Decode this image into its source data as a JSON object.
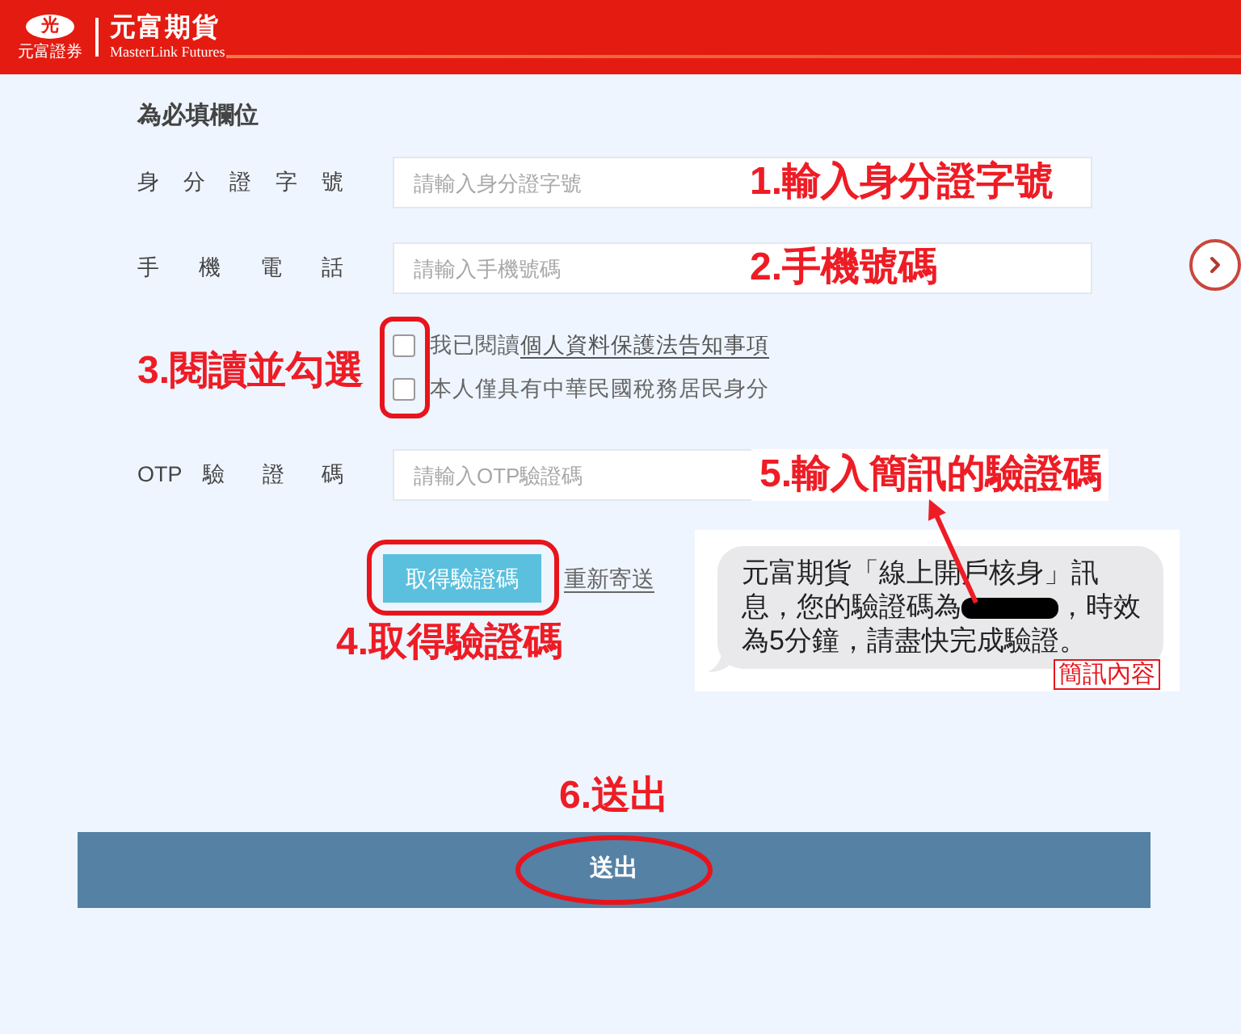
{
  "header": {
    "logo_mark": "光",
    "logo_caption": "元富證券",
    "brand_name": "元富期貨",
    "brand_name_en": "MasterLink Futures"
  },
  "form": {
    "required_note": "為必填欄位",
    "fields": [
      {
        "label": "身 分 證 字 號",
        "placeholder": "請輸入身分證字號",
        "annotation": "1.輸入身分證字號"
      },
      {
        "label": "手 機 電 話",
        "placeholder": "請輸入手機號碼",
        "annotation": "2.手機號碼"
      }
    ],
    "consent_annotation": "3.閱讀並勾選",
    "consents": [
      {
        "text": "我已閱讀",
        "link": "個人資料保護法告知事項",
        "checked": false
      },
      {
        "text": "本人僅具有中華民國稅務居民身分",
        "checked": false
      }
    ],
    "otp_field": {
      "label": "OTP 驗 證 碼",
      "placeholder": "請輸入OTP驗證碼",
      "annotation": "5.輸入簡訊的驗證碼"
    },
    "get_code_button": "取得驗證碼",
    "get_code_annotation": "4.取得驗證碼",
    "resend_link": "重新寄送"
  },
  "sms_preview": {
    "message_start": "元富期貨「線上開戶核身」訊息，您的驗證碼為",
    "message_end": "，時效為5分鐘，請盡快完成驗證。",
    "caption": "簡訊內容"
  },
  "submit": {
    "annotation": "6.送出",
    "button": "送出"
  }
}
